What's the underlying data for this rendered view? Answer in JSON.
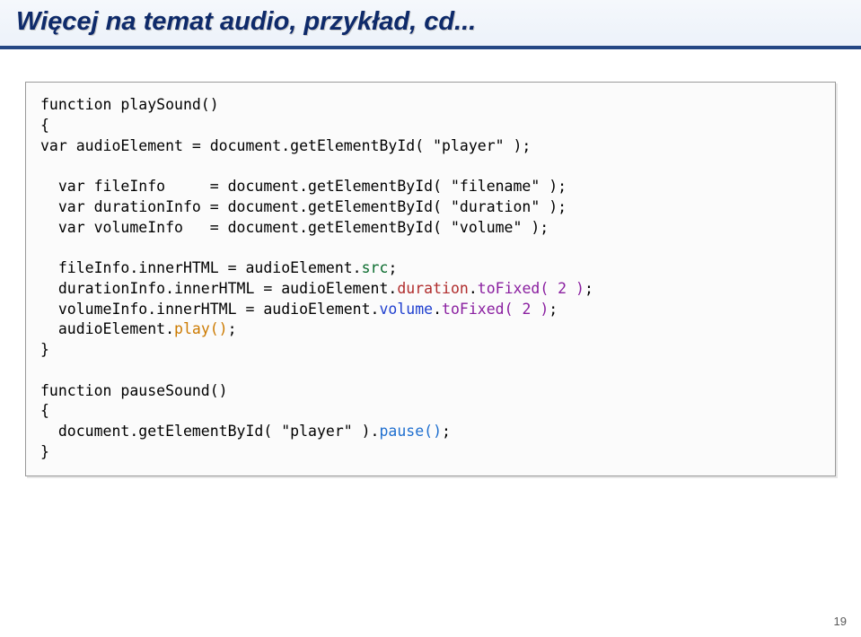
{
  "title": "Więcej na temat audio, przykład, cd...",
  "code": {
    "l1": "function playSound()",
    "l2": "{",
    "l3": "var audioElement = document.getElementById( \"player\" );",
    "l5": "  var fileInfo     = document.getElementById( \"filename\" );",
    "l6": "  var durationInfo = document.getElementById( \"duration\" );",
    "l7": "  var volumeInfo   = document.getElementById( \"volume\" );",
    "l9a": "  fileInfo.innerHTML = audioElement.",
    "l9b": "src",
    "l9c": ";",
    "l10a": "  durationInfo.innerHTML = audioElement.",
    "l10b": "duration",
    "l10c": ".",
    "l10d": "toFixed( 2 )",
    "l10e": ";",
    "l11a": "  volumeInfo.innerHTML = audioElement.",
    "l11b": "volume",
    "l11c": ".",
    "l11d": "toFixed( 2 )",
    "l11e": ";",
    "l12a": "  audioElement.",
    "l12b": "play()",
    "l12c": ";",
    "l13": "}",
    "l15": "function pauseSound()",
    "l16": "{",
    "l17a": "  document.getElementById( \"player\" ).",
    "l17b": "pause()",
    "l17c": ";",
    "l18": "}"
  },
  "page": "19"
}
